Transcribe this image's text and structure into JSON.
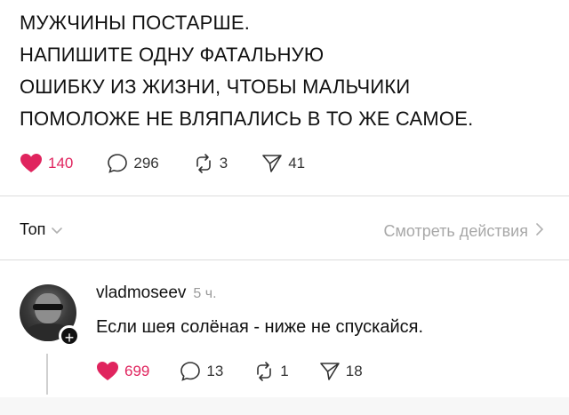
{
  "post": {
    "lines": [
      "МУЖЧИНЫ ПОСТАРШЕ.",
      "НАПИШИТЕ ОДНУ ФАТАЛЬНУЮ",
      "ОШИБКУ ИЗ ЖИЗНИ, ЧТОБЫ МАЛЬЧИКИ",
      "ПОМОЛОЖЕ НЕ ВЛЯПАЛИСЬ В ТО ЖЕ САМОЕ."
    ],
    "likes": "140",
    "replies": "296",
    "reposts": "3",
    "shares": "41"
  },
  "sort": {
    "label": "Топ"
  },
  "view_activity": {
    "label": "Смотреть действия"
  },
  "comment": {
    "username": "vladmoseev",
    "time": "5 ч.",
    "text": "Если шея солёная - ниже не спускайся.",
    "likes": "699",
    "replies": "13",
    "reposts": "1",
    "shares": "18"
  },
  "colors": {
    "like": "#e0245e",
    "muted": "#a8a8a8",
    "divider": "#dcdcdc"
  },
  "icons": [
    "heart-filled-icon",
    "comment-icon",
    "repost-icon",
    "share-icon",
    "chevron-down-icon",
    "chevron-right-icon",
    "plus-icon"
  ]
}
